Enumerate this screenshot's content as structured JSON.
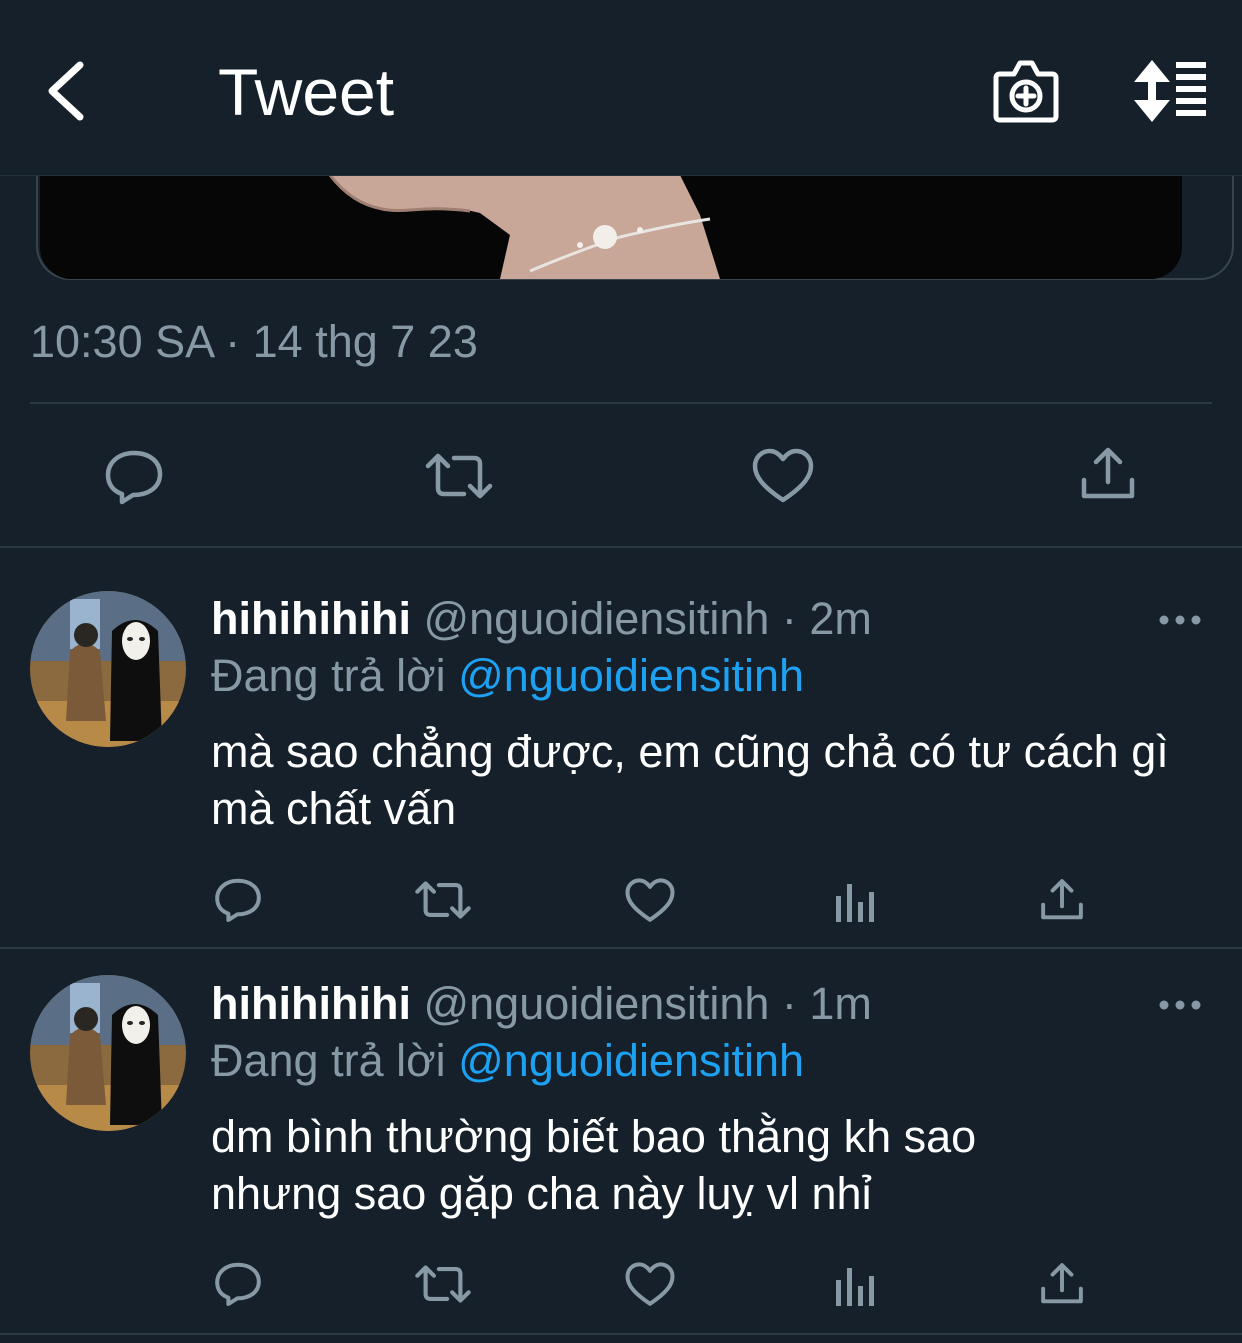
{
  "header": {
    "title": "Tweet",
    "back_icon": "chevron-left-icon",
    "camera_icon": "camera-plus-icon",
    "sort_icon": "sort-list-icon"
  },
  "tweet": {
    "timestamp": "10:30 SA · 14 thg 7 23"
  },
  "replies": [
    {
      "display_name": "hihihihihi",
      "handle": "@nguoidiensitinh",
      "time": "2m",
      "replying_prefix": "Đang trả lời",
      "replying_to": "@nguoidiensitinh",
      "text": "mà sao chẳng được, em cũng chả có tư cách gì mà chất vấn"
    },
    {
      "display_name": "hihihihihi",
      "handle": "@nguoidiensitinh",
      "time": "1m",
      "replying_prefix": "Đang trả lời",
      "replying_to": "@nguoidiensitinh",
      "text": "dm bình thường biết bao thằng kh sao nhưng sao gặp cha này luỵ vl nhỉ"
    }
  ],
  "colors": {
    "background": "#15202b",
    "muted_text": "#8899a6",
    "link": "#1da1f2",
    "divider": "#2b3944"
  }
}
